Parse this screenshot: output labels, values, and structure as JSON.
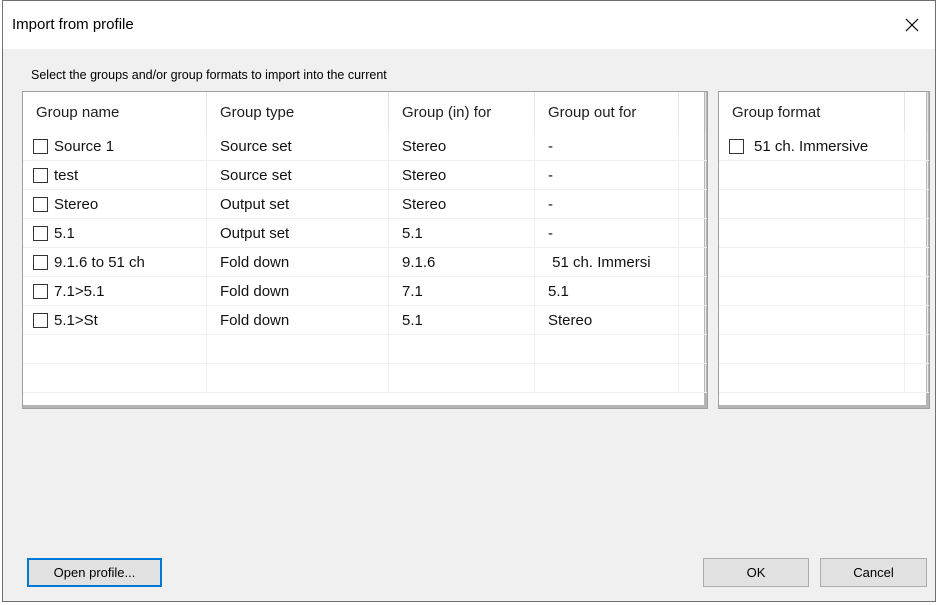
{
  "window": {
    "title": "Import from profile"
  },
  "instruction": "Select the groups and/or group formats to import into the current",
  "groups_table": {
    "headers": [
      "Group name",
      "Group type",
      "Group (in) for",
      "Group out for"
    ],
    "rows": [
      {
        "name": "Source 1",
        "type": "Source set",
        "in_for": "Stereo",
        "out_for": "-"
      },
      {
        "name": "test",
        "type": "Source set",
        "in_for": "Stereo",
        "out_for": "-"
      },
      {
        "name": "Stereo",
        "type": "Output set",
        "in_for": "Stereo",
        "out_for": "-"
      },
      {
        "name": "5.1",
        "type": "Output set",
        "in_for": "5.1",
        "out_for": "-"
      },
      {
        "name": "9.1.6 to 51 ch",
        "type": "Fold down",
        "in_for": "9.1.6",
        "out_for": " 51 ch. Immersi"
      },
      {
        "name": "7.1>5.1",
        "type": "Fold down",
        "in_for": "7.1",
        "out_for": "5.1"
      },
      {
        "name": "5.1>St",
        "type": "Fold down",
        "in_for": "5.1",
        "out_for": "Stereo"
      }
    ]
  },
  "formats_table": {
    "header": "Group format",
    "rows": [
      {
        "name": "51 ch. Immersive"
      }
    ]
  },
  "buttons": {
    "open_profile": "Open profile...",
    "ok": "OK",
    "cancel": "Cancel"
  }
}
